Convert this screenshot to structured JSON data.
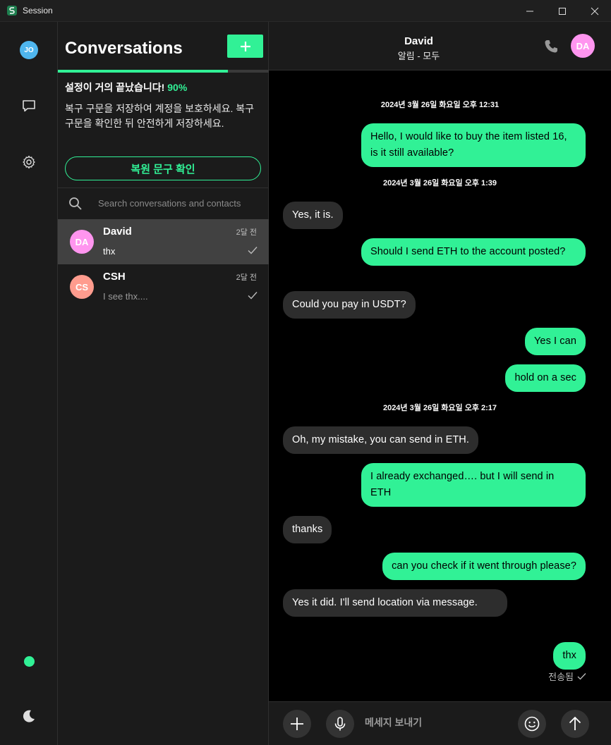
{
  "window": {
    "title": "Session"
  },
  "rail": {
    "avatar_initials": "JO",
    "status_color": "#31f196"
  },
  "conversations": {
    "title": "Conversations",
    "setup": {
      "title": "설정이 거의 끝났습니다!",
      "progress_label": "90%",
      "progress": 0.9,
      "description": "복구 구문을 저장하여 계정을 보호하세요. 복구 구문을 확인한 뒤 안전하게 저장하세요.",
      "button_label": "복원 문구 확인"
    },
    "search": {
      "placeholder": "Search conversations and contacts"
    },
    "items": [
      {
        "initials": "DA",
        "name": "David",
        "time": "2달 전",
        "preview": "thx",
        "avatar_color": "#ff95ef",
        "active": true
      },
      {
        "initials": "CS",
        "name": "CSH",
        "time": "2달 전",
        "preview": "I see thx....",
        "avatar_color": "#ff9c8e",
        "active": false
      }
    ]
  },
  "chat": {
    "header": {
      "name": "David",
      "subtitle": "알림 - 모두",
      "avatar_initials": "DA"
    },
    "dates": [
      "2024년 3월 26일 화요일 오후 12:31",
      "2024년 3월 26일 화요일 오후 1:39",
      "2024년 3월 26일 화요일 오후 2:17"
    ],
    "messages": [
      {
        "dir": "out",
        "text": "Hello, I would like to buy the item listed 16, is it still available?"
      },
      {
        "dir": "in",
        "text": "Yes, it is."
      },
      {
        "dir": "out",
        "text": "Should I send ETH to the account posted?"
      },
      {
        "dir": "in",
        "text": "Could you pay in USDT?"
      },
      {
        "dir": "out",
        "text": "Yes I can"
      },
      {
        "dir": "out",
        "text": "hold on a sec"
      },
      {
        "dir": "in",
        "text": "Oh, my mistake, you can send in ETH."
      },
      {
        "dir": "out",
        "text": "I already exchanged…. but I will send in ETH"
      },
      {
        "dir": "in",
        "text": "thanks"
      },
      {
        "dir": "out",
        "text": "can you check if it went through please?"
      },
      {
        "dir": "in",
        "text": "Yes it did. I'll send location via message."
      },
      {
        "dir": "out",
        "text": "thx"
      }
    ],
    "status": "전송됨",
    "composer": {
      "placeholder": "메세지 보내기"
    }
  },
  "colors": {
    "accent": "#31f196",
    "incoming_bubble": "#2d2d2d",
    "background": "#1b1b1b"
  }
}
